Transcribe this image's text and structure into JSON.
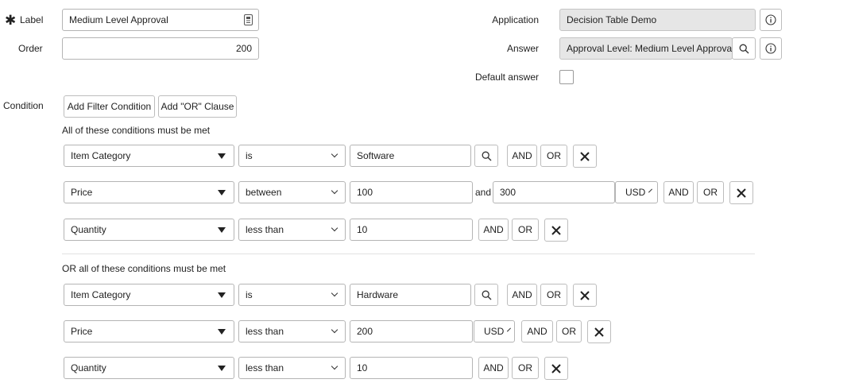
{
  "form": {
    "label_field": {
      "label": "Label",
      "required_mark": "✱",
      "value": "Medium Level Approval"
    },
    "order_field": {
      "label": "Order",
      "value": "200"
    },
    "application_field": {
      "label": "Application",
      "value": "Decision Table Demo"
    },
    "answer_field": {
      "label": "Answer",
      "value": "Approval Level: Medium Level Approval"
    },
    "default_answer": {
      "label": "Default answer",
      "checked": false
    }
  },
  "condition": {
    "label": "Condition",
    "add_filter_label": "Add Filter Condition",
    "add_or_label": "Add \"OR\" Clause",
    "groups": [
      {
        "heading": "All of these conditions must be met",
        "rows": [
          {
            "field": "Item Category",
            "operator": "is",
            "value": "Software"
          },
          {
            "field": "Price",
            "operator": "between",
            "value": "100",
            "and_label": "and",
            "value2": "300",
            "currency": "USD"
          },
          {
            "field": "Quantity",
            "operator": "less than",
            "value": "10"
          }
        ]
      },
      {
        "heading": "OR all of these conditions must be met",
        "rows": [
          {
            "field": "Item Category",
            "operator": "is",
            "value": "Hardware"
          },
          {
            "field": "Price",
            "operator": "less than",
            "value": "200",
            "currency": "USD"
          },
          {
            "field": "Quantity",
            "operator": "less than",
            "value": "10"
          }
        ]
      }
    ],
    "and_label": "AND",
    "or_label": "OR"
  },
  "icons": {
    "required": "asterisk-icon",
    "lang": "language-icon",
    "info": "info-icon",
    "search": "search-icon",
    "remove": "close-icon"
  }
}
